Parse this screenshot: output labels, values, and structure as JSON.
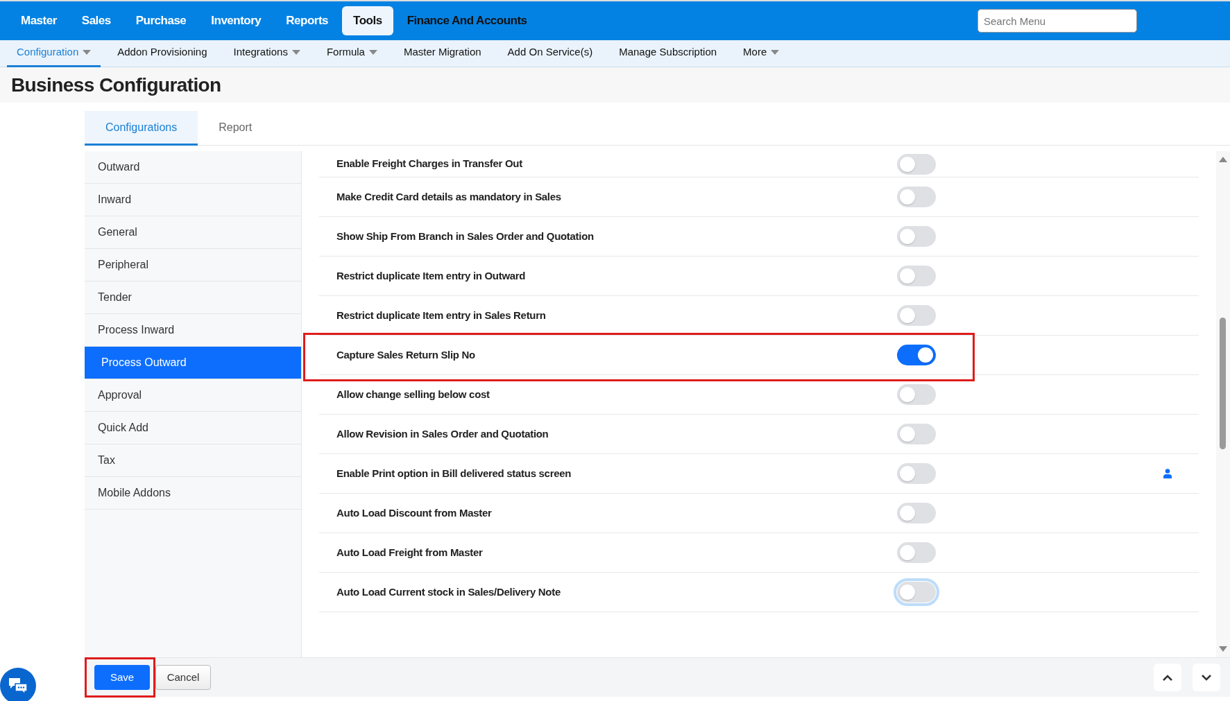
{
  "top_nav": {
    "items": [
      {
        "label": "Master",
        "selected": false
      },
      {
        "label": "Sales",
        "selected": false
      },
      {
        "label": "Purchase",
        "selected": false
      },
      {
        "label": "Inventory",
        "selected": false
      },
      {
        "label": "Reports",
        "selected": false
      },
      {
        "label": "Tools",
        "selected": true
      },
      {
        "label": "Finance And Accounts",
        "selected": false
      }
    ],
    "search": {
      "placeholder": "Search Menu"
    }
  },
  "sub_nav": [
    {
      "label": "Configuration",
      "selected": true,
      "dropdown": true
    },
    {
      "label": "Addon Provisioning",
      "selected": false,
      "dropdown": false
    },
    {
      "label": "Integrations",
      "selected": false,
      "dropdown": true
    },
    {
      "label": "Formula",
      "selected": false,
      "dropdown": true
    },
    {
      "label": "Master Migration",
      "selected": false,
      "dropdown": false
    },
    {
      "label": "Add On Service(s)",
      "selected": false,
      "dropdown": false
    },
    {
      "label": "Manage Subscription",
      "selected": false,
      "dropdown": false
    },
    {
      "label": "More",
      "selected": false,
      "dropdown": true
    }
  ],
  "page_title": "Business Configuration",
  "tabs": [
    {
      "label": "Configurations",
      "selected": true
    },
    {
      "label": "Report",
      "selected": false
    }
  ],
  "sidebar": {
    "items": [
      {
        "label": "Outward",
        "selected": false
      },
      {
        "label": "Inward",
        "selected": false
      },
      {
        "label": "General",
        "selected": false
      },
      {
        "label": "Peripheral",
        "selected": false
      },
      {
        "label": "Tender",
        "selected": false
      },
      {
        "label": "Process Inward",
        "selected": false
      },
      {
        "label": "Process Outward",
        "selected": true
      },
      {
        "label": "Approval",
        "selected": false
      },
      {
        "label": "Quick Add",
        "selected": false
      },
      {
        "label": "Tax",
        "selected": false
      },
      {
        "label": "Mobile Addons",
        "selected": false
      }
    ]
  },
  "settings": [
    {
      "label": "Enable Freight Charges in Transfer Out",
      "on": false,
      "focused": false,
      "user_icon": false,
      "highlighted": false
    },
    {
      "label": "Make Credit Card details as mandatory in Sales",
      "on": false,
      "focused": false,
      "user_icon": false,
      "highlighted": false
    },
    {
      "label": "Show Ship From Branch in Sales Order and Quotation",
      "on": false,
      "focused": false,
      "user_icon": false,
      "highlighted": false
    },
    {
      "label": "Restrict duplicate Item entry in Outward",
      "on": false,
      "focused": false,
      "user_icon": false,
      "highlighted": false
    },
    {
      "label": "Restrict duplicate Item entry in Sales Return",
      "on": false,
      "focused": false,
      "user_icon": false,
      "highlighted": false
    },
    {
      "label": "Capture Sales Return Slip No",
      "on": true,
      "focused": false,
      "user_icon": false,
      "highlighted": true
    },
    {
      "label": "Allow change selling below cost",
      "on": false,
      "focused": false,
      "user_icon": false,
      "highlighted": false
    },
    {
      "label": "Allow Revision in Sales Order and Quotation",
      "on": false,
      "focused": false,
      "user_icon": false,
      "highlighted": false
    },
    {
      "label": "Enable Print option in Bill delivered status screen",
      "on": false,
      "focused": false,
      "user_icon": true,
      "highlighted": false
    },
    {
      "label": "Auto Load Discount from Master",
      "on": false,
      "focused": false,
      "user_icon": false,
      "highlighted": false
    },
    {
      "label": "Auto Load Freight from Master",
      "on": false,
      "focused": false,
      "user_icon": false,
      "highlighted": false
    },
    {
      "label": "Auto Load Current stock in Sales/Delivery Note",
      "on": false,
      "focused": true,
      "user_icon": false,
      "highlighted": false
    }
  ],
  "footer": {
    "buttons": [
      {
        "label": "Save",
        "kind": "primary",
        "highlighted": true
      },
      {
        "label": "Cancel",
        "kind": "secondary",
        "highlighted": false
      }
    ]
  }
}
